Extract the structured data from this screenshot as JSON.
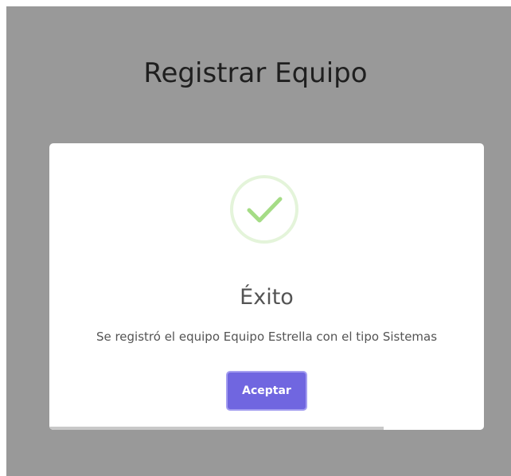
{
  "page": {
    "title": "Registrar Equipo"
  },
  "modal": {
    "icon": "success-check-icon",
    "icon_color": "#a5dc86",
    "title": "Éxito",
    "message": "Se registró el equipo Equipo Estrella con el tipo Sistemas",
    "confirm_label": "Aceptar",
    "confirm_color": "#7066e0",
    "timer_progress_fraction": 0.77
  }
}
